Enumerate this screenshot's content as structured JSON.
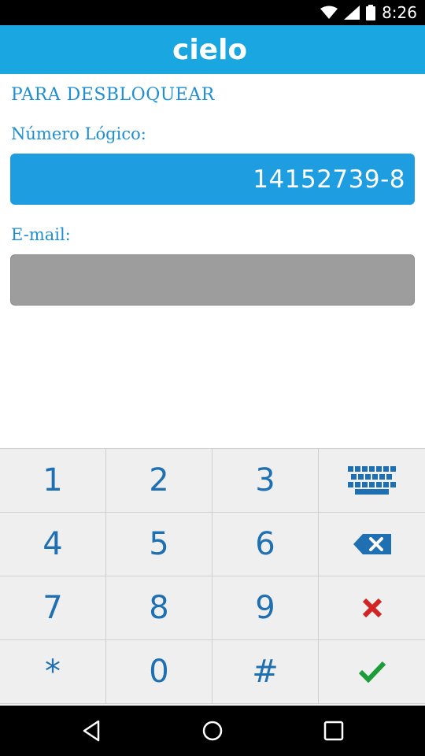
{
  "status_bar": {
    "time": "8:26"
  },
  "header": {
    "logo_text": "cielo",
    "brand_color": "#1aa7e1"
  },
  "form": {
    "title": "PARA DESBLOQUEAR",
    "numero_label": "Número Lógico:",
    "numero_value": "14152739-8",
    "email_label": "E-mail:",
    "email_value": ""
  },
  "keypad": {
    "keys": [
      "1",
      "2",
      "3",
      "keyboard-icon",
      "4",
      "5",
      "6",
      "backspace-icon",
      "7",
      "8",
      "9",
      "cancel-icon",
      "*",
      "0",
      "#",
      "confirm-icon"
    ],
    "digit_color": "#1f6fb3",
    "cancel_color": "#d32424",
    "confirm_color": "#1d9d3a"
  },
  "nav_bar": {
    "buttons": [
      "back-icon",
      "home-icon",
      "recents-icon"
    ]
  }
}
